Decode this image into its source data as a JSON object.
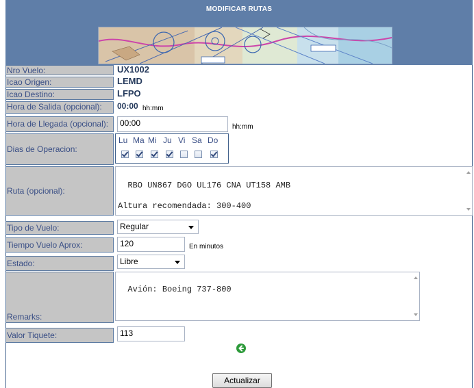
{
  "page": {
    "title": "MODIFICAR RUTAS"
  },
  "fields": {
    "nro_vuelo": {
      "label": "Nro Vuelo:",
      "value": "UX1002"
    },
    "icao_origen": {
      "label": "Icao Origen:",
      "value": "LEMD"
    },
    "icao_destino": {
      "label": "Icao Destino:",
      "value": "LFPO"
    },
    "hora_salida": {
      "label": "Hora de Salida (opcional):",
      "value": "00:00",
      "unit": "hh:mm"
    },
    "hora_llegada": {
      "label": "Hora de Llegada (opcional):",
      "value": "00:00",
      "unit": "hh:mm"
    },
    "dias": {
      "label": "Dias de Operacion:",
      "days": [
        {
          "label": "Lu",
          "checked": true
        },
        {
          "label": "Ma",
          "checked": true
        },
        {
          "label": "Mi",
          "checked": true
        },
        {
          "label": "Ju",
          "checked": true
        },
        {
          "label": "Vi",
          "checked": false
        },
        {
          "label": "Sa",
          "checked": false
        },
        {
          "label": "Do",
          "checked": true
        }
      ]
    },
    "ruta": {
      "label": "Ruta (opcional):",
      "value": "RBO UN867 DGO UL176 CNA UT158 AMB\n\nAltura recomendada: 300-400"
    },
    "tipo_vuelo": {
      "label": "Tipo de Vuelo:",
      "value": "Regular"
    },
    "tiempo_vuelo": {
      "label": "Tiempo Vuelo Aprox:",
      "value": "120",
      "unit": "En minutos"
    },
    "estado": {
      "label": "Estado:",
      "value": "Libre"
    },
    "remarks": {
      "label": "Remarks:",
      "value": "Avión: Boeing 737-800"
    },
    "valor_tiquete": {
      "label": "Valor Tiquete:",
      "value": "113"
    }
  },
  "actions": {
    "submit": "Actualizar",
    "back_icon": "back-arrow-icon"
  },
  "colors": {
    "header": "#5f7ea8",
    "label_bg": "#c5c5c5",
    "border": "#41618c",
    "back_icon": "#2d9a3a"
  }
}
